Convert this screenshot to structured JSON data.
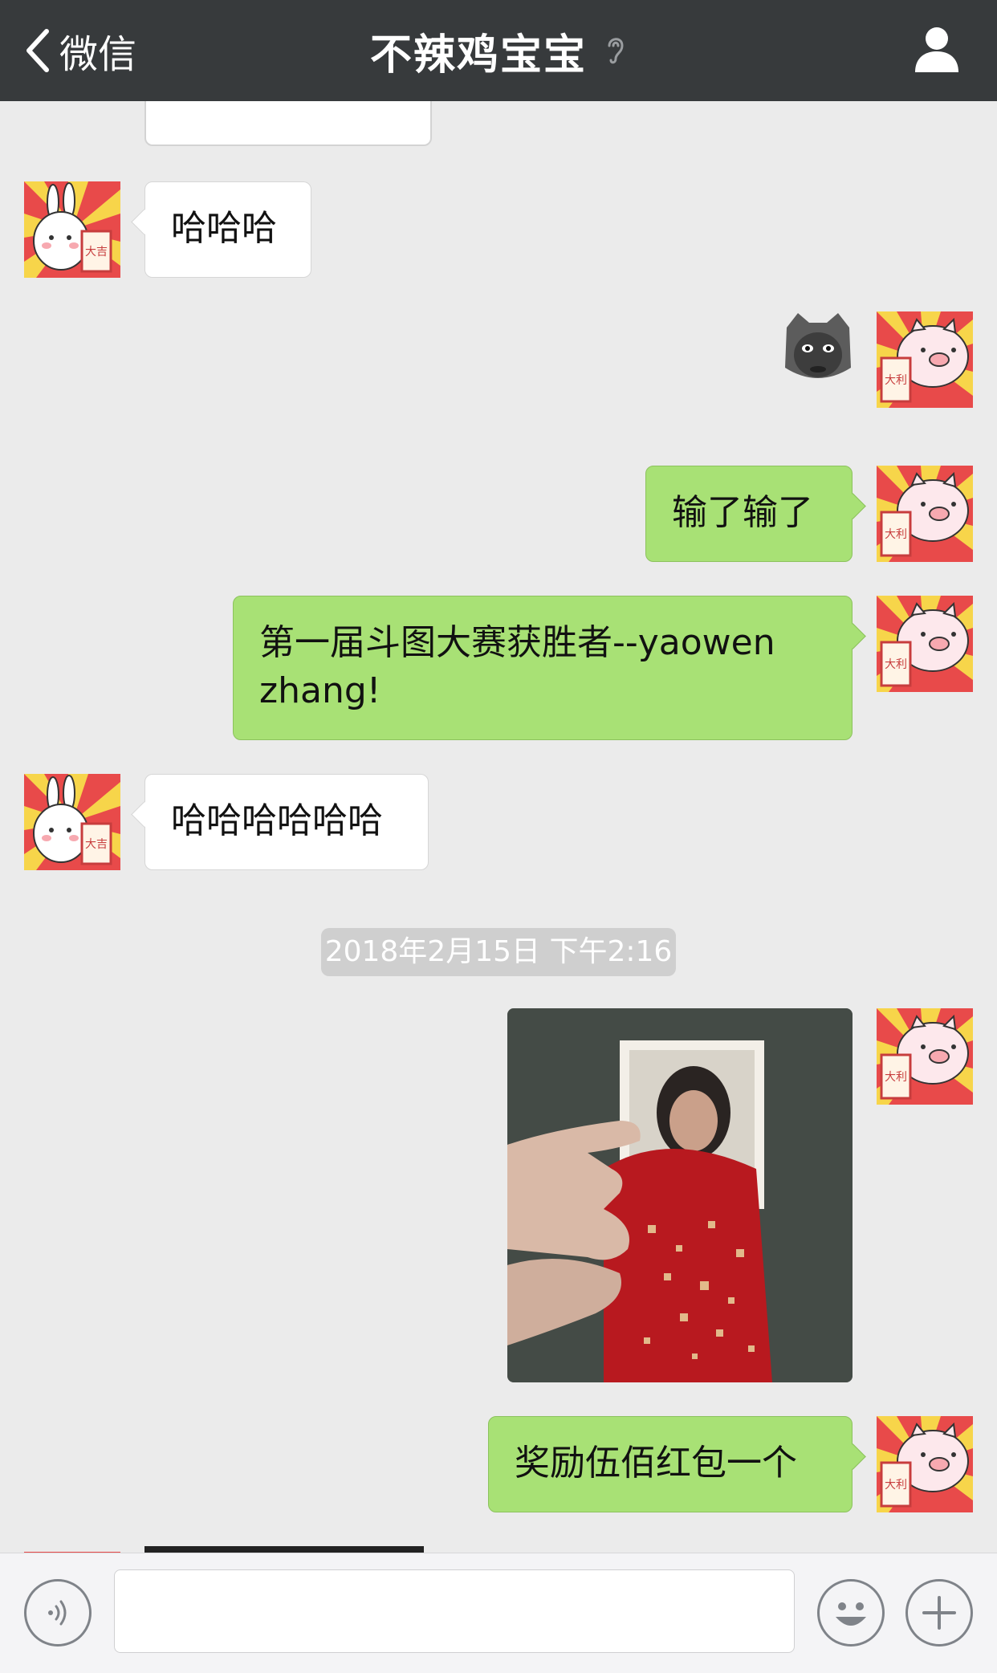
{
  "header": {
    "back_label": "微信",
    "title": "不辣鸡宝宝"
  },
  "messages": [
    {
      "side": "in",
      "type": "text",
      "text": "哈哈哈"
    },
    {
      "side": "out",
      "type": "sticker",
      "sticker": "cat-face-sticker"
    },
    {
      "side": "out",
      "type": "text",
      "text": "输了输了"
    },
    {
      "side": "out",
      "type": "text",
      "text": "第一届斗图大赛获胜者--yaowen zhang!"
    },
    {
      "side": "in",
      "type": "text",
      "text": "哈哈哈哈哈哈"
    },
    {
      "side": "out",
      "type": "image",
      "image": "photo-with-red-envelope"
    },
    {
      "side": "out",
      "type": "text",
      "text": "奖励伍佰红包一个"
    }
  ],
  "timestamp": "2018年2月15日 下午2:16",
  "avatars": {
    "contact": {
      "icon": "bunny-avatar",
      "badge": "大吉"
    },
    "me": {
      "icon": "pig-avatar",
      "badge": "大利"
    }
  },
  "colors": {
    "header_bg": "#373a3c",
    "chat_bg": "#ebebeb",
    "out_bubble": "#a8e175",
    "in_bubble": "#ffffff",
    "avatar_red": "#e84a4a",
    "avatar_yellow": "#f7d54a"
  },
  "input_bar": {
    "placeholder": "",
    "icons": [
      "voice-icon",
      "emoji-icon",
      "plus-icon"
    ]
  }
}
